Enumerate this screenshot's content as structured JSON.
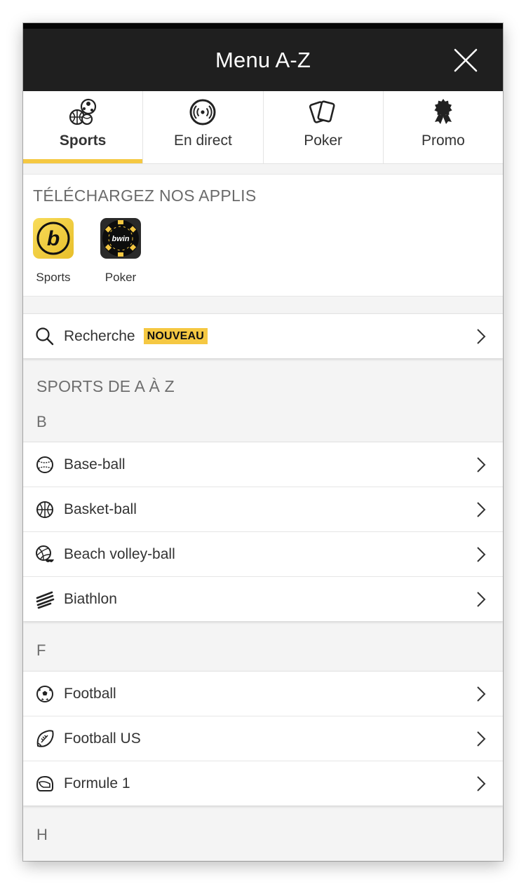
{
  "header": {
    "title": "Menu A-Z",
    "close_icon": "close-icon"
  },
  "tabs": [
    {
      "label": "Sports",
      "icon": "sports-balls-icon",
      "active": true
    },
    {
      "label": "En direct",
      "icon": "live-broadcast-icon",
      "active": false
    },
    {
      "label": "Poker",
      "icon": "playing-cards-icon",
      "active": false
    },
    {
      "label": "Promo",
      "icon": "award-ribbon-icon",
      "active": false
    }
  ],
  "apps": {
    "title": "TÉLÉCHARGEZ NOS APPLIS",
    "items": [
      {
        "label": "Sports",
        "icon": "bwin-sports-app-icon",
        "icon_text": "b"
      },
      {
        "label": "Poker",
        "icon": "bwin-poker-app-icon",
        "icon_text": "bwin"
      }
    ]
  },
  "search": {
    "label": "Recherche",
    "badge": "NOUVEAU",
    "icon": "search-icon"
  },
  "sports_az": {
    "title": "SPORTS DE A À Z",
    "groups": [
      {
        "letter": "B",
        "items": [
          {
            "label": "Base-ball",
            "icon": "baseball-icon"
          },
          {
            "label": "Basket-ball",
            "icon": "basketball-icon"
          },
          {
            "label": "Beach volley-ball",
            "icon": "beach-volleyball-icon"
          },
          {
            "label": "Biathlon",
            "icon": "biathlon-icon"
          }
        ]
      },
      {
        "letter": "F",
        "items": [
          {
            "label": "Football",
            "icon": "soccer-ball-icon"
          },
          {
            "label": "Football US",
            "icon": "american-football-icon"
          },
          {
            "label": "Formule 1",
            "icon": "racing-helmet-icon"
          }
        ]
      },
      {
        "letter": "H",
        "items": []
      }
    ]
  },
  "colors": {
    "accent": "#f5c842",
    "header_bg": "#1f1f1f",
    "text": "#333333",
    "muted": "#6e6e6e",
    "page_bg": "#f4f4f4"
  }
}
